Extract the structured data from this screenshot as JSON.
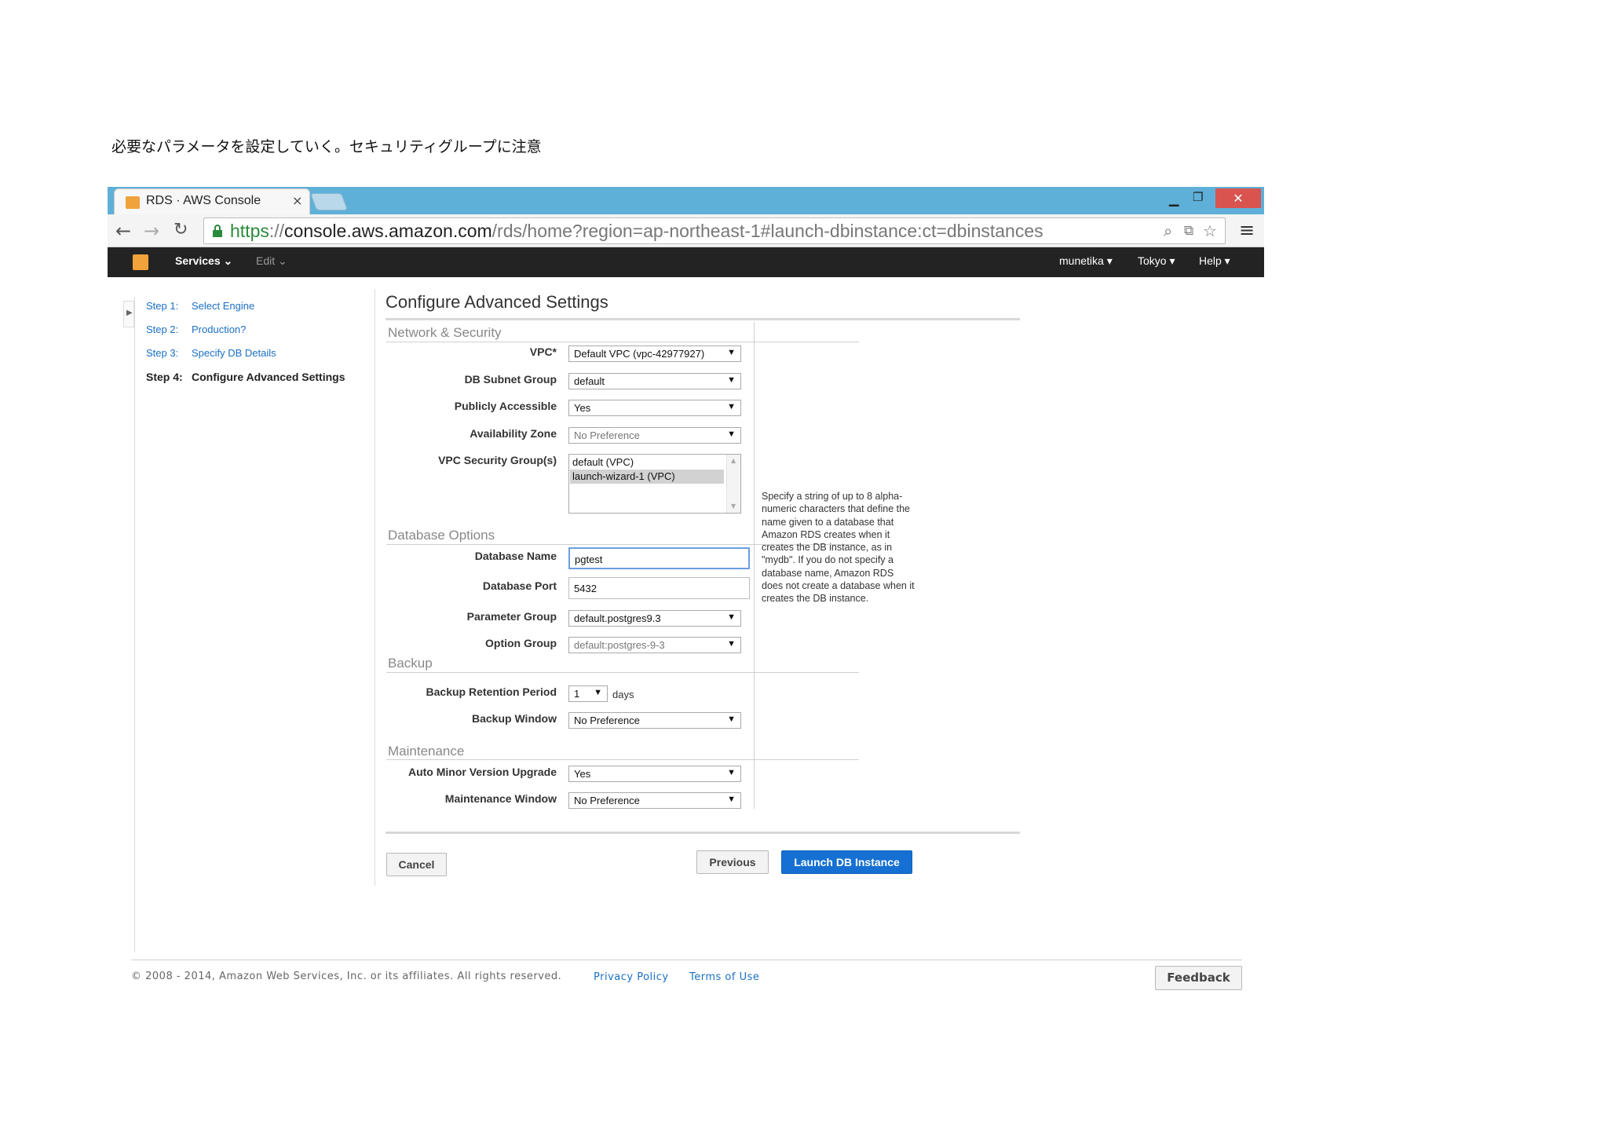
{
  "caption": "必要なパラメータを設定していく。セキュリティグループに注意",
  "browser": {
    "tab_title": "RDS · AWS Console",
    "tab_close": "×",
    "url_proto": "https",
    "url_sep": "://",
    "url_host": "console.aws.amazon.com",
    "url_path": "/rds/home?region=ap-northeast-1#launch-dbinstance:ct=dbinstances"
  },
  "aws_nav": {
    "services": "Services",
    "edit": "Edit",
    "user": "munetika",
    "region": "Tokyo",
    "help": "Help"
  },
  "wizard": {
    "steps": [
      {
        "num": "Step 1:",
        "label": "Select Engine"
      },
      {
        "num": "Step 2:",
        "label": "Production?"
      },
      {
        "num": "Step 3:",
        "label": "Specify DB Details"
      },
      {
        "num": "Step 4:",
        "label": "Configure Advanced Settings"
      }
    ]
  },
  "page": {
    "title": "Configure Advanced Settings"
  },
  "network": {
    "section": "Network & Security",
    "vpc_label": "VPC*",
    "vpc_value": "Default VPC (vpc-42977927)",
    "subnet_label": "DB Subnet Group",
    "subnet_value": "default",
    "public_label": "Publicly Accessible",
    "public_value": "Yes",
    "az_label": "Availability Zone",
    "az_value": "No Preference",
    "sg_label": "VPC Security Group(s)",
    "sg_options": [
      "default (VPC)",
      "launch-wizard-1 (VPC)"
    ]
  },
  "database": {
    "section": "Database Options",
    "name_label": "Database Name",
    "name_value": "pgtest",
    "port_label": "Database Port",
    "port_value": "5432",
    "param_label": "Parameter Group",
    "param_value": "default.postgres9.3",
    "option_label": "Option Group",
    "option_value": "default:postgres-9-3",
    "help_text": "Specify a string of up to 8 alpha-numeric characters that define the name given to a database that Amazon RDS creates when it creates the DB instance, as in \"mydb\". If you do not specify a database name, Amazon RDS does not create a database when it creates the DB instance."
  },
  "backup": {
    "section": "Backup",
    "retention_label": "Backup Retention Period",
    "retention_value": "1",
    "retention_unit": "days",
    "window_label": "Backup Window",
    "window_value": "No Preference"
  },
  "maintenance": {
    "section": "Maintenance",
    "auto_label": "Auto Minor Version Upgrade",
    "auto_value": "Yes",
    "window_label": "Maintenance Window",
    "window_value": "No Preference"
  },
  "buttons": {
    "cancel": "Cancel",
    "previous": "Previous",
    "launch": "Launch DB Instance"
  },
  "footer": {
    "copyright": "© 2008 - 2014, Amazon Web Services, Inc. or its affiliates. All rights reserved.",
    "privacy": "Privacy Policy",
    "terms": "Terms of Use",
    "feedback": "Feedback"
  },
  "colors": {
    "titlebar": "#5fb0d8",
    "aws_bar": "#232323",
    "link": "#1a6fc4",
    "primary_button": "#1670d3",
    "close_button": "#d9534f"
  }
}
